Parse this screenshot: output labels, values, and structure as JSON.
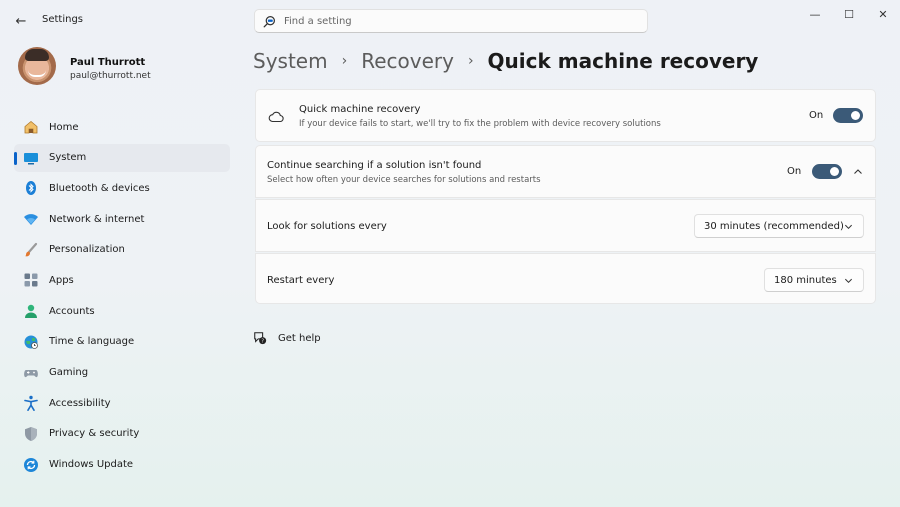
{
  "window": {
    "app_title": "Settings",
    "controls": {
      "minimize": "—",
      "maximize": "☐",
      "close": "✕"
    }
  },
  "search": {
    "placeholder": "Find a setting"
  },
  "profile": {
    "name": "Paul Thurrott",
    "email": "paul@thurrott.net"
  },
  "sidebar": {
    "items": [
      {
        "label": "Home",
        "icon": "home-icon"
      },
      {
        "label": "System",
        "icon": "system-icon",
        "active": true
      },
      {
        "label": "Bluetooth & devices",
        "icon": "bluetooth-icon"
      },
      {
        "label": "Network & internet",
        "icon": "wifi-icon"
      },
      {
        "label": "Personalization",
        "icon": "brush-icon"
      },
      {
        "label": "Apps",
        "icon": "apps-icon"
      },
      {
        "label": "Accounts",
        "icon": "person-icon"
      },
      {
        "label": "Time & language",
        "icon": "globe-clock-icon"
      },
      {
        "label": "Gaming",
        "icon": "gamepad-icon"
      },
      {
        "label": "Accessibility",
        "icon": "accessibility-icon"
      },
      {
        "label": "Privacy & security",
        "icon": "shield-icon"
      },
      {
        "label": "Windows Update",
        "icon": "update-icon"
      }
    ]
  },
  "breadcrumb": {
    "items": [
      "System",
      "Recovery"
    ],
    "current": "Quick machine recovery",
    "separator": "›"
  },
  "settings": {
    "qmr": {
      "title": "Quick machine recovery",
      "subtitle": "If your device fails to start, we'll try to fix the problem with device recovery solutions",
      "state": "On"
    },
    "continue": {
      "title": "Continue searching if a solution isn't found",
      "subtitle": "Select how often your device searches for solutions and restarts",
      "state": "On"
    },
    "look_for": {
      "label": "Look for solutions every",
      "value": "30 minutes (recommended)"
    },
    "restart": {
      "label": "Restart every",
      "value": "180 minutes"
    }
  },
  "help": {
    "label": "Get help"
  },
  "colors": {
    "accent": "#0a63c9",
    "toggle_on": "#3b5a78"
  }
}
